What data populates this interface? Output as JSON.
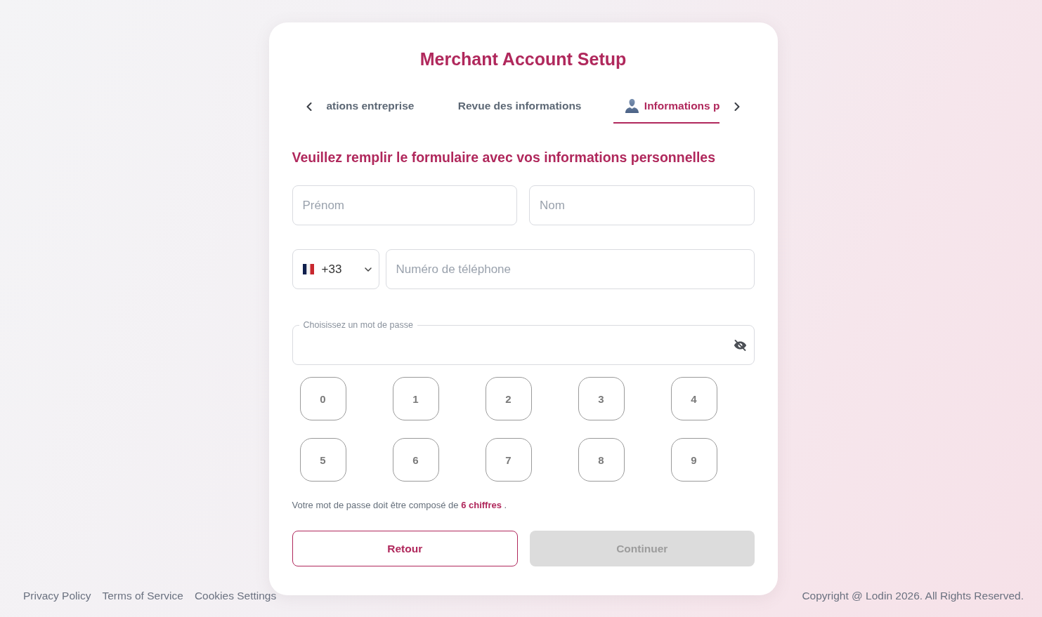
{
  "title": "Merchant Account Setup",
  "tabs": {
    "items": [
      {
        "label": "ations entreprise",
        "selected": false
      },
      {
        "label": "Revue des informations",
        "selected": false
      },
      {
        "label": "Informations p",
        "selected": true
      }
    ]
  },
  "heading": "Veuillez remplir le formulaire avec vos informations personnelles",
  "name_fields": [
    {
      "placeholder": "Prénom"
    },
    {
      "placeholder": "Nom"
    }
  ],
  "phone": {
    "country_code": "+33",
    "placeholder": "Numéro de téléphone"
  },
  "password": {
    "label": "Choisissez un mot de passe"
  },
  "keypad": [
    "0",
    "1",
    "2",
    "3",
    "4",
    "5",
    "6",
    "7",
    "8",
    "9"
  ],
  "hint": "Votre mot de passe doit être composé de **6 chiffres** .",
  "actions": [
    {
      "label": "Retour",
      "kind": "secondary",
      "disabled": false
    },
    {
      "label": "Continuer",
      "kind": "primary",
      "disabled": true
    }
  ],
  "footer": {
    "links": [
      "Privacy Policy",
      "Terms of Service",
      "Cookies Settings"
    ],
    "copyright": "Copyright @ Lodin 2026. All Rights Reserved."
  }
}
